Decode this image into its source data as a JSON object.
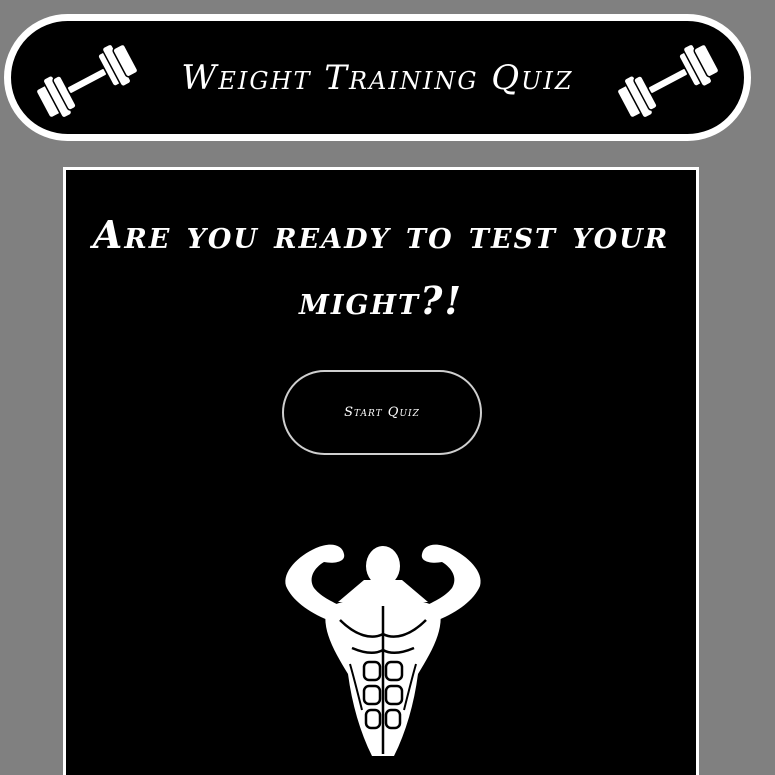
{
  "header": {
    "title": "Weight Training Quiz",
    "left_icon": "dumbbell-icon",
    "right_icon": "dumbbell-icon"
  },
  "main": {
    "headline": "Are you ready to test your might?!",
    "start_button_label": "Start Quiz",
    "illustration": "bodybuilder-icon"
  },
  "colors": {
    "page_background": "#808080",
    "panel_background": "#000000",
    "foreground": "#ffffff"
  }
}
